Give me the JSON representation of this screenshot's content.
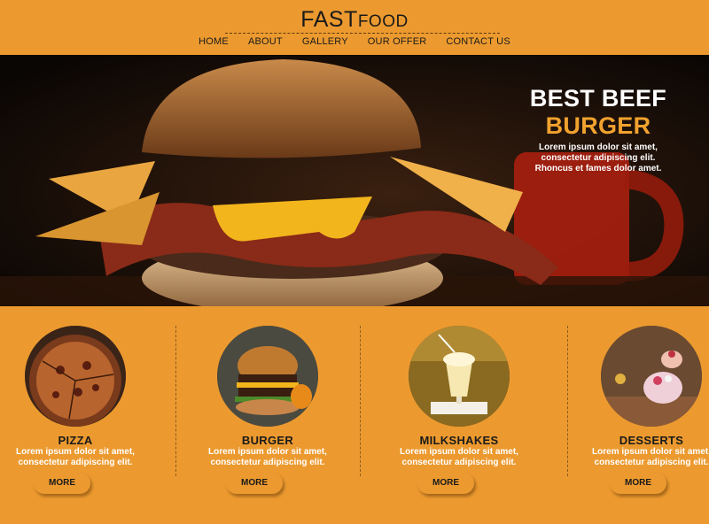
{
  "brand": {
    "part1": "FAST",
    "part2": "FOOD"
  },
  "nav": [
    "HOME",
    "ABOUT",
    "GALLERY",
    "OUR OFFER",
    "CONTACT US"
  ],
  "hero": {
    "line1": "BEST BEEF",
    "line2": "BURGER",
    "desc1": "Lorem ipsum dolor sit amet,",
    "desc2": "consectetur adipiscing elit.",
    "desc3": "Rhoncus et fames dolor amet."
  },
  "products": [
    {
      "title": "PIZZA",
      "desc1": "Lorem ipsum dolor sit amet,",
      "desc2": "consectetur adipiscing elit.",
      "button": "MORE"
    },
    {
      "title": "BURGER",
      "desc1": "Lorem ipsum dolor sit amet,",
      "desc2": "consectetur adipiscing elit.",
      "button": "MORE"
    },
    {
      "title": "MILKSHAKES",
      "desc1": "Lorem ipsum dolor sit amet,",
      "desc2": "consectetur adipiscing elit.",
      "button": "MORE"
    },
    {
      "title": "DESSERTS",
      "desc1": "Lorem ipsum dolor sit amet,",
      "desc2": "consectetur adipiscing elit.",
      "button": "MORE"
    }
  ],
  "colors": {
    "background": "#ec9a2f",
    "accent": "#f1a22e",
    "hero_bg": "#120a05"
  }
}
